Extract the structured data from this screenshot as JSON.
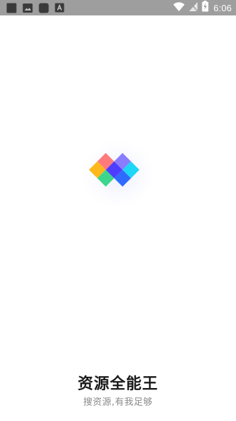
{
  "status_bar": {
    "time": "6:06",
    "notification_icons": [
      "square-notification-icon",
      "image-notification-icon",
      "app-notification-icon",
      "text-notification-icon"
    ],
    "system_icons": [
      "wifi-icon",
      "no-sim-icon",
      "battery-charging-icon"
    ]
  },
  "splash": {
    "logo": "app-logo",
    "title": "资源全能王",
    "slogan": "搜资源,有我足够"
  },
  "colors": {
    "status_bar_bg": "#9e9e9e",
    "background": "#ffffff",
    "title": "#1a1a1a",
    "slogan": "#8a8a8a"
  }
}
